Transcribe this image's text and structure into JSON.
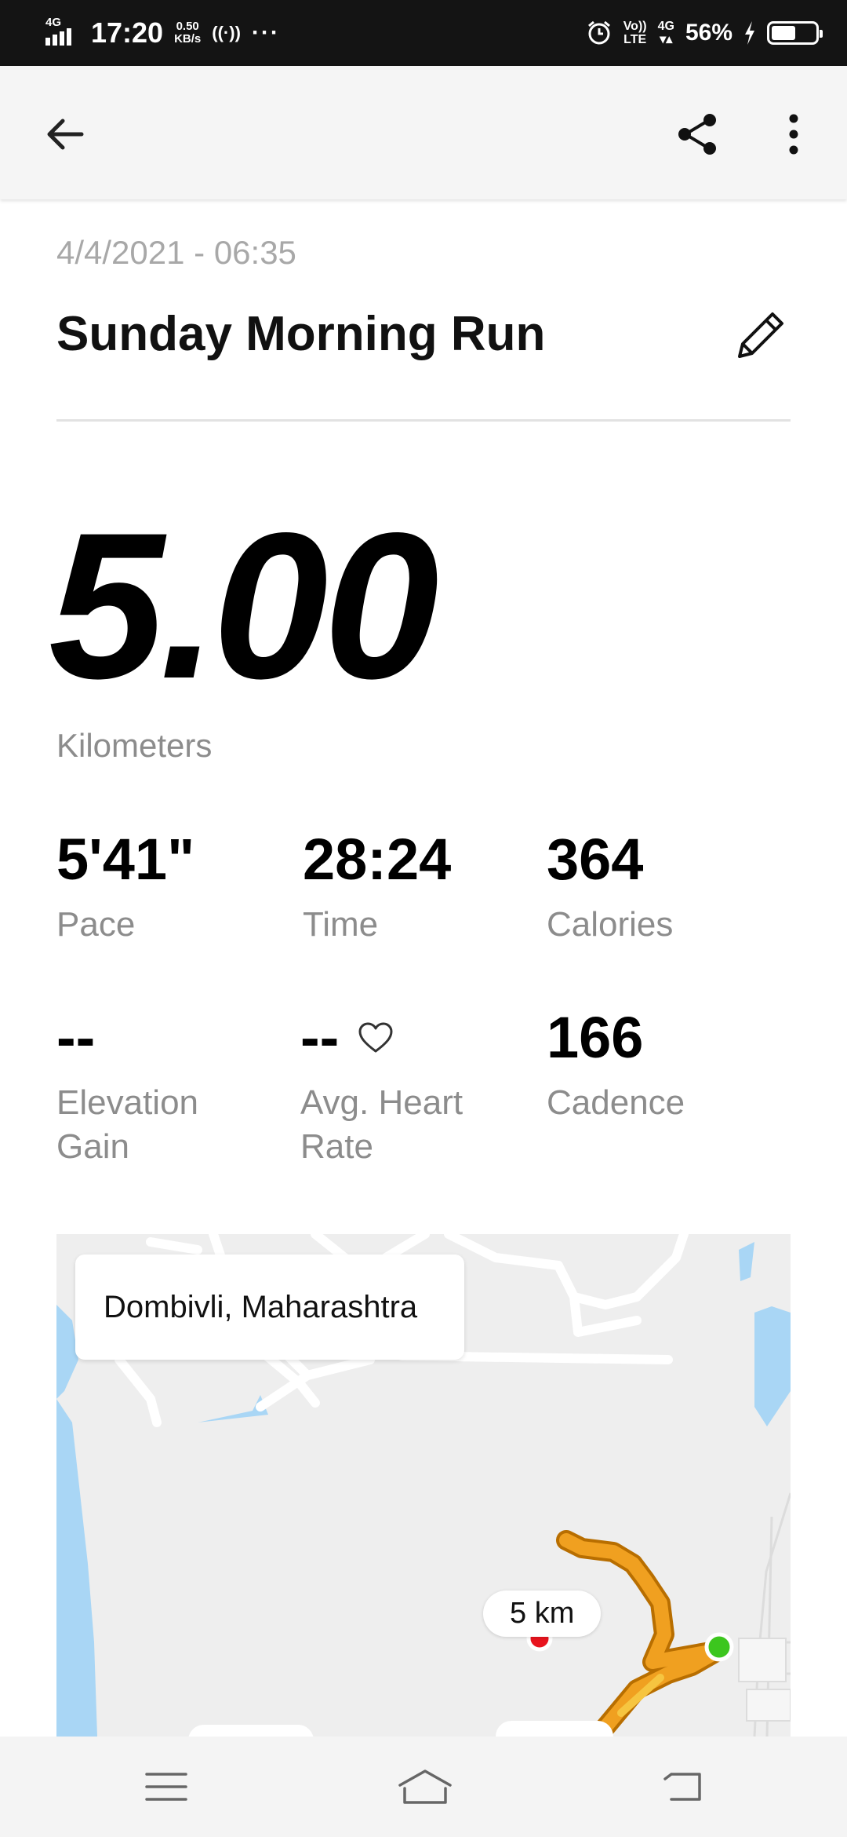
{
  "status_bar": {
    "network": "4G",
    "time": "17:20",
    "speed_value": "0.50",
    "speed_unit": "KB/s",
    "hotspot": "((·))",
    "more": "···",
    "volte_top": "Vo))",
    "volte_bottom": "LTE",
    "net2": "4G",
    "battery_percent": "56%",
    "battery_level": 0.56
  },
  "app_bar": {
    "back_icon": "arrow-left-icon",
    "share_icon": "share-icon",
    "menu_icon": "more-vertical-icon"
  },
  "activity": {
    "date": "4/4/2021 - 06:35",
    "title": "Sunday Morning Run",
    "distance": "5.00",
    "distance_unit": "Kilometers"
  },
  "stats": [
    {
      "value": "5'41\"",
      "label": "Pace"
    },
    {
      "value": "28:24",
      "label": "Time"
    },
    {
      "value": "364",
      "label": "Calories"
    },
    {
      "value": "--",
      "label": "Elevation Gain"
    },
    {
      "value": "--",
      "label": "Avg. Heart Rate"
    },
    {
      "value": "166",
      "label": "Cadence"
    }
  ],
  "map": {
    "location": "Dombivli, Maharashtra",
    "marker_label": "5 km",
    "route_color": "#f0a020",
    "start_color": "#3cc61e",
    "end_color": "#e8141e",
    "water_color": "#a9d6f5"
  },
  "nav_bar": {
    "menu_icon": "menu-icon",
    "home_icon": "home-icon",
    "back_icon": "back-icon"
  }
}
